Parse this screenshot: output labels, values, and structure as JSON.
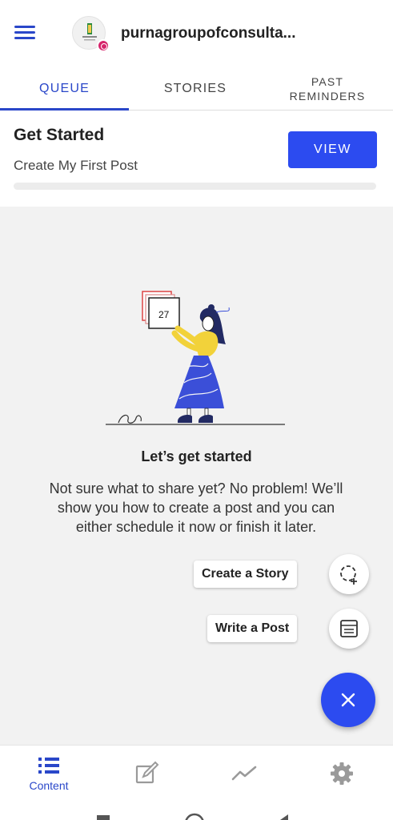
{
  "header": {
    "account_name": "purnagroupofconsulta...",
    "avatar_icon": "brand-logo-icon",
    "badge_icon": "instagram-icon"
  },
  "tabs": [
    {
      "label": "QUEUE",
      "active": true
    },
    {
      "label": "STORIES",
      "active": false
    },
    {
      "label": "PAST REMINDERS",
      "active": false
    }
  ],
  "get_started": {
    "title": "Get Started",
    "subtitle": "Create My First Post",
    "view_label": "VIEW",
    "progress": 0
  },
  "empty_state": {
    "calendar_number": "27",
    "title": "Let’s get started",
    "description": "Not sure what to share yet? No problem! We’ll show you how to create a post and you can either schedule it now or finish it later."
  },
  "fab": {
    "create_story_label": "Create a Story",
    "write_post_label": "Write a Post",
    "main_icon": "close-icon"
  },
  "bottom_nav": {
    "content_label": "Content",
    "items": [
      "list-icon",
      "compose-icon",
      "analytics-icon",
      "settings-icon"
    ]
  },
  "colors": {
    "accent": "#2c4bf0",
    "tab_active": "#2a47c9",
    "background": "#f2f2f2",
    "skirt": "#3b4fd8",
    "sweater": "#f2d23a"
  }
}
